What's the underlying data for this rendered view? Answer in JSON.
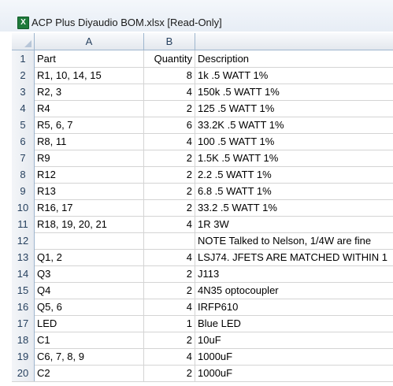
{
  "window": {
    "title": "ACP Plus Diyaudio BOM.xlsx  [Read-Only]",
    "icon": "excel-icon"
  },
  "columns": [
    "A",
    "B"
  ],
  "rows": [
    {
      "n": "1",
      "a": "Part",
      "b": "Quantity",
      "c": "Description"
    },
    {
      "n": "2",
      "a": "R1, 10, 14, 15",
      "b": "8",
      "c": "1k .5 WATT 1%"
    },
    {
      "n": "3",
      "a": "R2, 3",
      "b": "4",
      "c": "150k .5 WATT 1%"
    },
    {
      "n": "4",
      "a": "R4",
      "b": "2",
      "c": "125 .5 WATT 1%"
    },
    {
      "n": "5",
      "a": "R5, 6, 7",
      "b": "6",
      "c": "33.2K .5 WATT 1%"
    },
    {
      "n": "6",
      "a": "R8, 11",
      "b": "4",
      "c": "100 .5 WATT 1%"
    },
    {
      "n": "7",
      "a": "R9",
      "b": "2",
      "c": "1.5K .5 WATT 1%"
    },
    {
      "n": "8",
      "a": "R12",
      "b": "2",
      "c": "2.2 .5 WATT 1%"
    },
    {
      "n": "9",
      "a": "R13",
      "b": "2",
      "c": "6.8 .5 WATT 1%"
    },
    {
      "n": "10",
      "a": "R16, 17",
      "b": "2",
      "c": "33.2 .5 WATT 1%"
    },
    {
      "n": "11",
      "a": "R18, 19, 20, 21",
      "b": "4",
      "c": "1R 3W"
    },
    {
      "n": "12",
      "a": "",
      "b": "",
      "c": "NOTE Talked to Nelson, 1/4W are fine"
    },
    {
      "n": "13",
      "a": "Q1, 2",
      "b": "4",
      "c": "LSJ74. JFETS ARE MATCHED WITHIN 1"
    },
    {
      "n": "14",
      "a": "Q3",
      "b": "2",
      "c": "J113"
    },
    {
      "n": "15",
      "a": "Q4",
      "b": "2",
      "c": "4N35  optocoupler"
    },
    {
      "n": "16",
      "a": "Q5, 6",
      "b": "4",
      "c": "IRFP610"
    },
    {
      "n": "17",
      "a": "LED",
      "b": "1",
      "c": "Blue LED"
    },
    {
      "n": "18",
      "a": "C1",
      "b": "2",
      "c": "10uF"
    },
    {
      "n": "19",
      "a": "C6, 7, 8, 9",
      "b": "4",
      "c": "1000uF"
    },
    {
      "n": "20",
      "a": "C2",
      "b": "2",
      "c": "1000uF"
    }
  ]
}
